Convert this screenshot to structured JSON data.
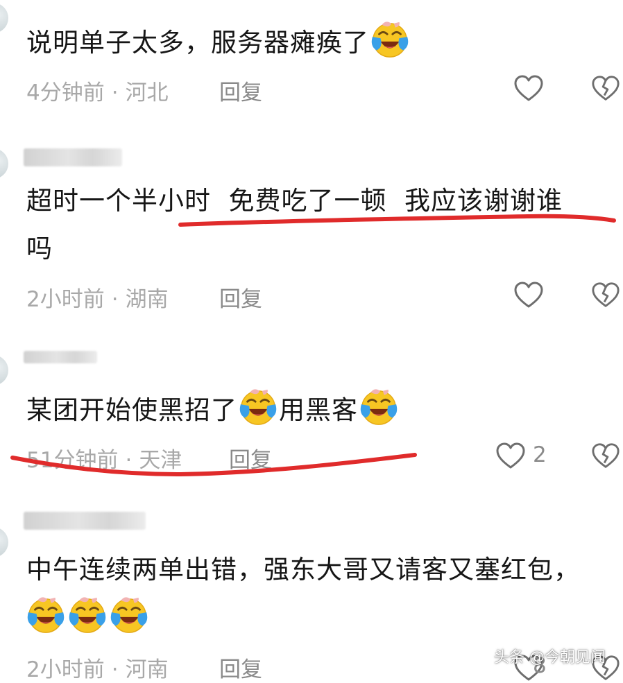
{
  "comments": [
    {
      "text": "说明单子太多，服务器瘫痪了",
      "time": "4分钟前",
      "separator": "·",
      "region": "河北",
      "reply_label": "回复",
      "likes": ""
    },
    {
      "text_line1": "超时一个半小时  免费吃了一顿  我应该谢谢谁",
      "text_line2": "吗",
      "time": "2小时前",
      "separator": "·",
      "region": "湖南",
      "reply_label": "回复",
      "likes": ""
    },
    {
      "text_a": "某团开始使黑招了",
      "text_b": "用黑客",
      "time": "51分钟前",
      "separator": "·",
      "region": "天津",
      "reply_label": "回复",
      "likes": "2"
    },
    {
      "text_line1": "中午连续两单出错，强东大哥又请客又塞红包，",
      "time": "2小时前",
      "separator": "·",
      "region": "河南",
      "reply_label": "回复",
      "likes": "8"
    }
  ],
  "watermark": "头条 @今朝见闻",
  "colors": {
    "annotation_underline": "#e02b2b",
    "meta_text": "#a8a8a8",
    "emoji_face": "#f7c623",
    "emoji_tears": "#3aa0e8"
  },
  "icons": [
    "heart-outline-icon",
    "broken-heart-icon",
    "laughing-crying-emoji-icon"
  ]
}
